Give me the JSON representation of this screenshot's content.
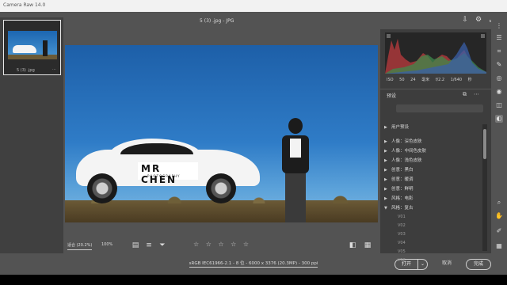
{
  "window": {
    "title": "Camera Raw 14.0"
  },
  "topbar": {
    "filename": "5 (3) .jpg - JPG"
  },
  "filmstrip": {
    "thumb_name": "5 (3) .jpg"
  },
  "photo": {
    "plate_line1": "MR CHEN",
    "plate_line2": "PHOTOGRAPHY"
  },
  "toolbar": {
    "zoom_label": "适合 (20.2%)",
    "zoom_value": "100%",
    "stars": "☆ ☆ ☆ ☆ ☆"
  },
  "info": {
    "text": "sRGB IEC61966-2.1 - 8 位 - 6000 x 3376 (20.3MP) - 300 ppi"
  },
  "buttons": {
    "open": "打开",
    "open_arrow": "⌄",
    "cancel": "取消",
    "done": "完成"
  },
  "camera": {
    "iso": "ISO 50",
    "focal": "24 毫米",
    "aperture": "f/2.2",
    "shutter": "1/640 秒"
  },
  "presets": {
    "title": "预设",
    "items": [
      {
        "label": "用户预设",
        "arrow": "▶",
        "kind": "group"
      },
      {
        "label": "人像：深色皮肤",
        "arrow": "▶",
        "kind": "item"
      },
      {
        "label": "人像：中间色皮肤",
        "arrow": "▶",
        "kind": "item"
      },
      {
        "label": "人像：浅色皮肤",
        "arrow": "▶",
        "kind": "item"
      },
      {
        "label": "创意：黑白",
        "arrow": "▶",
        "kind": "item"
      },
      {
        "label": "创意：暖调",
        "arrow": "▶",
        "kind": "item"
      },
      {
        "label": "创意：鲜明",
        "arrow": "▶",
        "kind": "item"
      },
      {
        "label": "风格：电影",
        "arrow": "▶",
        "kind": "item"
      },
      {
        "label": "风格：复古",
        "arrow": "▼",
        "kind": "item"
      },
      {
        "label": "V01",
        "arrow": "",
        "kind": "sub"
      },
      {
        "label": "V02",
        "arrow": "",
        "kind": "sub"
      },
      {
        "label": "V03",
        "arrow": "",
        "kind": "sub"
      },
      {
        "label": "V04",
        "arrow": "",
        "kind": "sub"
      },
      {
        "label": "V05",
        "arrow": "",
        "kind": "sub"
      },
      {
        "label": "V06",
        "arrow": "",
        "kind": "sub"
      }
    ]
  },
  "colors": {
    "accent": "#ffffff",
    "panel": "#3d3d3d",
    "workspace": "#535353"
  }
}
